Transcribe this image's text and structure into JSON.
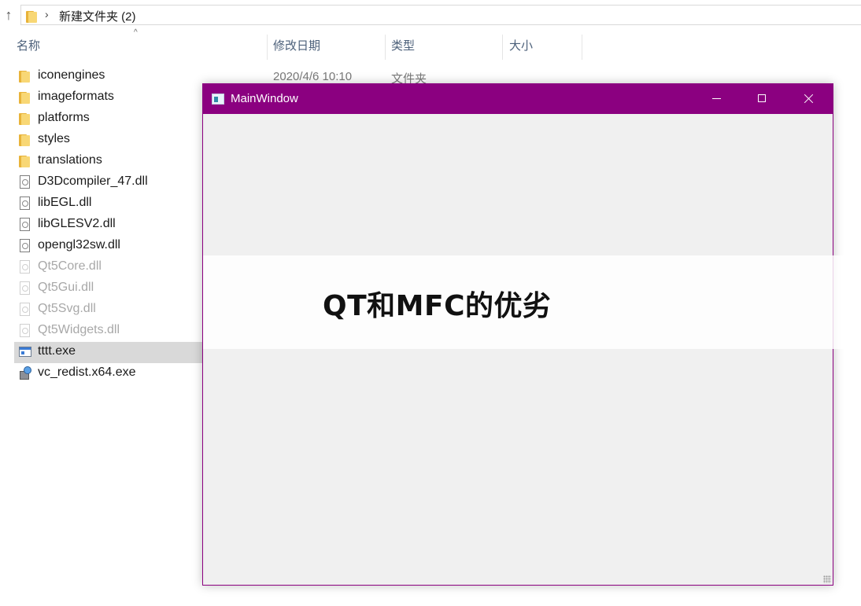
{
  "address_bar": {
    "breadcrumb": "新建文件夹 (2)"
  },
  "columns": {
    "name": "名称",
    "modified": "修改日期",
    "type": "类型",
    "size": "大小"
  },
  "first_row_details": {
    "modified": "2020/4/6 10:10",
    "type": "文件夹"
  },
  "files": [
    {
      "name": "iconengines",
      "icon": "folder-icon"
    },
    {
      "name": "imageformats",
      "icon": "folder-icon"
    },
    {
      "name": "platforms",
      "icon": "folder-icon"
    },
    {
      "name": "styles",
      "icon": "folder-icon"
    },
    {
      "name": "translations",
      "icon": "folder-icon"
    },
    {
      "name": "D3Dcompiler_47.dll",
      "icon": "dll-file-icon"
    },
    {
      "name": "libEGL.dll",
      "icon": "dll-file-icon"
    },
    {
      "name": "libGLESV2.dll",
      "icon": "dll-file-icon"
    },
    {
      "name": "opengl32sw.dll",
      "icon": "dll-file-icon"
    },
    {
      "name": "Qt5Core.dll",
      "icon": "dll-file-icon",
      "dimmed": true
    },
    {
      "name": "Qt5Gui.dll",
      "icon": "dll-file-icon",
      "dimmed": true
    },
    {
      "name": "Qt5Svg.dll",
      "icon": "dll-file-icon",
      "dimmed": true
    },
    {
      "name": "Qt5Widgets.dll",
      "icon": "dll-file-icon",
      "dimmed": true
    },
    {
      "name": "tttt.exe",
      "icon": "exe-icon",
      "selected": true
    },
    {
      "name": "vc_redist.x64.exe",
      "icon": "installer-icon"
    }
  ],
  "qt_window": {
    "title": "MainWindow",
    "accent_color": "#8b0080",
    "body_color": "#f0f0f0"
  },
  "overlay": {
    "text": "QT和MFC的优劣"
  }
}
